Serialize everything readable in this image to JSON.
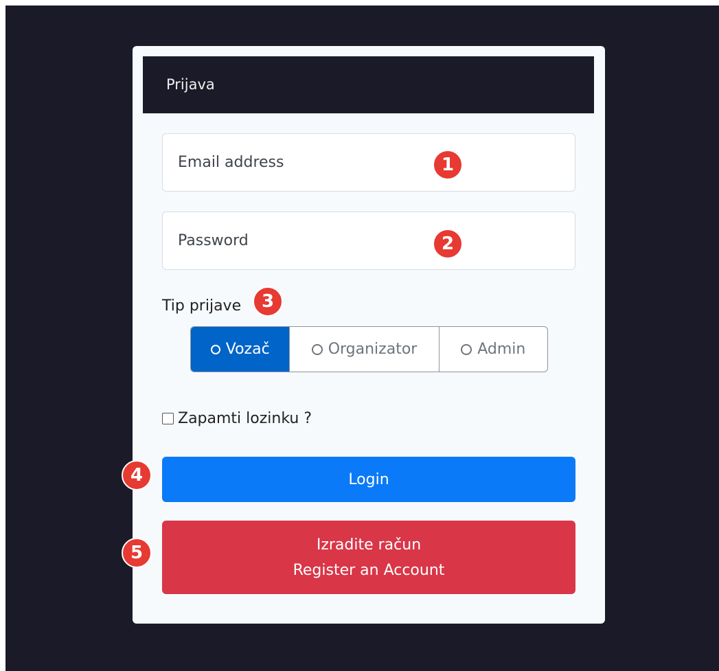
{
  "header": {
    "title": "Prijava"
  },
  "form": {
    "email_placeholder": "Email address",
    "password_placeholder": "Password",
    "type_label": "Tip prijave",
    "types": [
      {
        "label": "Vozač",
        "selected": true
      },
      {
        "label": "Organizator",
        "selected": false
      },
      {
        "label": "Admin",
        "selected": false
      }
    ],
    "remember_label": "Zapamti lozinku ?",
    "login_label": "Login",
    "register_line1": "Izradite račun",
    "register_line2": "Register an Account"
  },
  "annotations": [
    "1",
    "2",
    "3",
    "4",
    "5"
  ],
  "colors": {
    "background": "#1b1a28",
    "card": "#f7fafd",
    "selected_radio": "#0064c8",
    "login": "#0a7af8",
    "register": "#d93648",
    "badge": "#e63a32"
  }
}
